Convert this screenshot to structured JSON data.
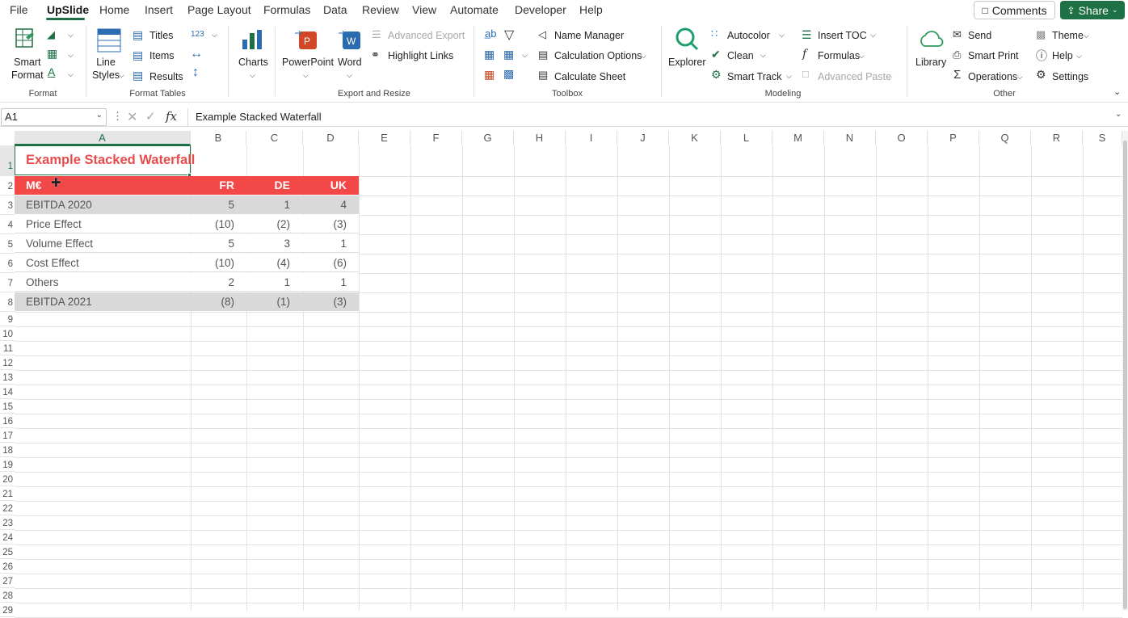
{
  "menu": {
    "tabs": [
      "File",
      "UpSlide",
      "Home",
      "Insert",
      "Page Layout",
      "Formulas",
      "Data",
      "Review",
      "View",
      "Automate",
      "Developer",
      "Help"
    ],
    "active_tab": "UpSlide",
    "comments_label": "Comments",
    "share_label": "Share"
  },
  "ribbon": {
    "format": {
      "smart_format": "Smart\nFormat",
      "label": "Format"
    },
    "format_tables": {
      "line_styles": "Line\nStyles",
      "titles": "Titles",
      "items": "Items",
      "results": "Results",
      "num_format": "123",
      "label": "Format Tables"
    },
    "charts": {
      "label_btn": "Charts"
    },
    "export": {
      "powerpoint": "PowerPoint",
      "word": "Word",
      "advanced_export": "Advanced Export",
      "highlight_links": "Highlight Links",
      "label": "Export and Resize"
    },
    "toolbox": {
      "name_manager": "Name Manager",
      "calculation_options": "Calculation Options",
      "calculate_sheet": "Calculate Sheet",
      "label": "Toolbox"
    },
    "modeling": {
      "explorer": "Explorer",
      "autocolor": "Autocolor",
      "clean": "Clean",
      "smart_track": "Smart Track",
      "insert_toc": "Insert TOC",
      "formulas": "Formulas",
      "advanced_paste": "Advanced Paste",
      "label": "Modeling"
    },
    "other": {
      "library": "Library",
      "send": "Send",
      "smart_print": "Smart Print",
      "operations": "Operations",
      "theme": "Theme",
      "help": "Help",
      "settings": "Settings",
      "label": "Other"
    }
  },
  "formula_bar": {
    "name_box": "A1",
    "fx": "fx",
    "content": "Example Stacked Waterfall"
  },
  "sheet": {
    "columns": [
      "A",
      "B",
      "C",
      "D",
      "E",
      "F",
      "G",
      "H",
      "I",
      "J",
      "K",
      "L",
      "M",
      "N",
      "O",
      "P",
      "Q",
      "R",
      "S"
    ],
    "rows": [
      "1",
      "2",
      "3",
      "4",
      "5",
      "6",
      "7",
      "8",
      "9",
      "10",
      "11",
      "12",
      "13",
      "14",
      "15",
      "16",
      "17",
      "18",
      "19",
      "20",
      "21",
      "22",
      "23",
      "24",
      "25",
      "26",
      "27",
      "28",
      "29"
    ],
    "title": "Example Stacked Waterfall",
    "header": {
      "unit": "M€",
      "c1": "FR",
      "c2": "DE",
      "c3": "UK"
    },
    "data_rows": [
      {
        "label": "EBITDA 2020",
        "fr": "5",
        "de": "1",
        "uk": "4"
      },
      {
        "label": "Price Effect",
        "fr": "(10)",
        "de": "(2)",
        "uk": "(3)"
      },
      {
        "label": "Volume Effect",
        "fr": "5",
        "de": "3",
        "uk": "1"
      },
      {
        "label": "Cost Effect",
        "fr": "(10)",
        "de": "(4)",
        "uk": "(6)"
      },
      {
        "label": "Others",
        "fr": "2",
        "de": "1",
        "uk": "1"
      },
      {
        "label": "EBITDA 2021",
        "fr": "(8)",
        "de": "(1)",
        "uk": "(3)"
      }
    ]
  },
  "colors": {
    "excel_green": "#1e7145",
    "header_red": "#f24848",
    "title_red": "#e84c4c",
    "total_grey": "#d9d9d9"
  }
}
